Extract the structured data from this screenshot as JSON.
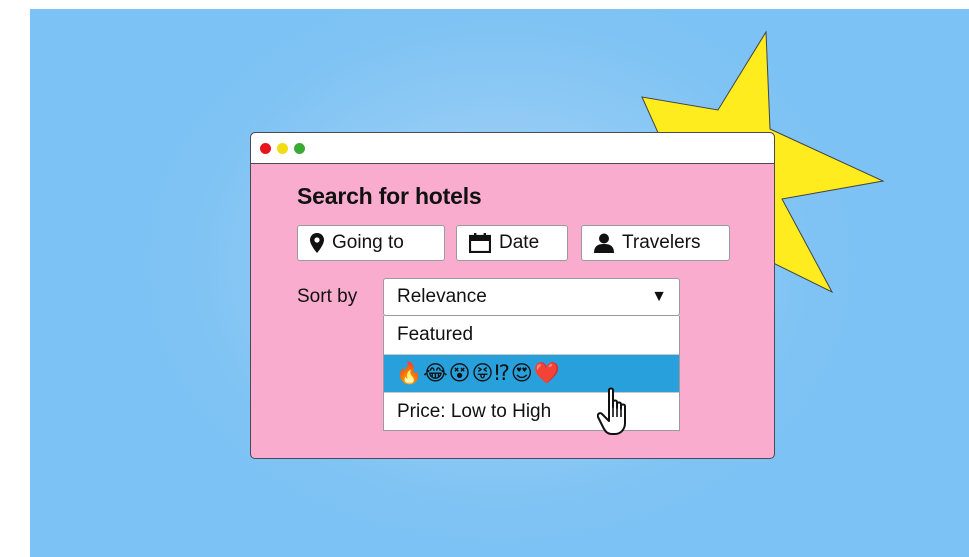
{
  "window": {
    "title": "Search for hotels"
  },
  "search": {
    "going_to_label": "Going to",
    "date_label": "Date",
    "travelers_label": "Travelers"
  },
  "sort": {
    "label": "Sort by",
    "selected": "Relevance",
    "arrow": "▼",
    "options": [
      {
        "label": "Featured"
      },
      {
        "label": "🔥😂😵😝⁉😍❤️"
      },
      {
        "label": "Price: Low to High"
      }
    ]
  },
  "icons": {
    "going_to": "map-pin-icon",
    "date": "calendar-icon",
    "travelers": "person-icon",
    "cursor": "hand-pointer-icon"
  },
  "colors": {
    "background": "#7cc2f4",
    "window_body": "#f9acce",
    "highlight": "#28a0dc",
    "starburst": "#ffec1f",
    "dot_red": "#e8141b",
    "dot_yellow": "#f1dc16",
    "dot_green": "#3aaa35"
  }
}
